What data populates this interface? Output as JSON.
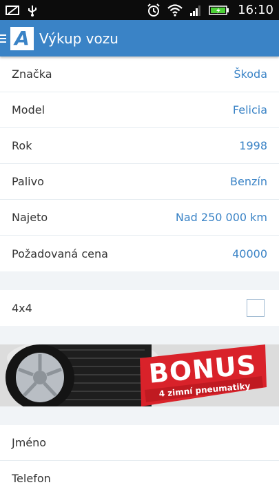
{
  "statusbar": {
    "time": "16:10",
    "left_icons": [
      "notification-icon",
      "usb-icon"
    ],
    "right_icons": [
      "alarm-icon",
      "wifi-icon",
      "signal-icon",
      "battery-icon"
    ]
  },
  "appbar": {
    "logo_letter": "A",
    "title": "Výkup vozu"
  },
  "fields": [
    {
      "label": "Značka",
      "value": "Škoda"
    },
    {
      "label": "Model",
      "value": "Felicia"
    },
    {
      "label": "Rok",
      "value": "1998"
    },
    {
      "label": "Palivo",
      "value": "Benzín"
    },
    {
      "label": "Najeto",
      "value": "Nad 250 000 km"
    },
    {
      "label": "Požadovaná cena",
      "value": "40000"
    }
  ],
  "option_4x4": {
    "label": "4x4",
    "checked": false
  },
  "banner": {
    "title": "BONUS",
    "subtitle": "4 zimní pneumatiky"
  },
  "contact_fields": [
    {
      "label": "Jméno"
    },
    {
      "label": "Telefon"
    }
  ],
  "colors": {
    "accent": "#3a83c6",
    "section_gap": "#f1f4f7",
    "bonus_red": "#d9222a"
  }
}
